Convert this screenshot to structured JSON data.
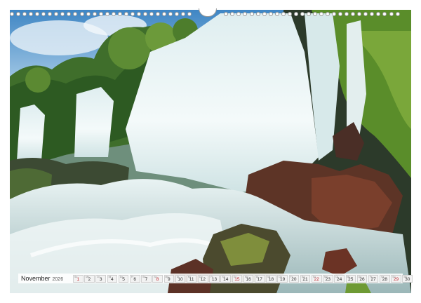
{
  "calendar": {
    "month": "November",
    "year": "2026",
    "days": [
      {
        "n": "1",
        "w": "So",
        "sun": true
      },
      {
        "n": "2",
        "w": "Mo"
      },
      {
        "n": "3",
        "w": "Di"
      },
      {
        "n": "4",
        "w": "Mi"
      },
      {
        "n": "5",
        "w": "Do"
      },
      {
        "n": "6",
        "w": "Fr"
      },
      {
        "n": "7",
        "w": "Sa"
      },
      {
        "n": "8",
        "w": "So",
        "sun": true
      },
      {
        "n": "9",
        "w": "Mo"
      },
      {
        "n": "10",
        "w": "Di"
      },
      {
        "n": "11",
        "w": "Mi"
      },
      {
        "n": "12",
        "w": "Do"
      },
      {
        "n": "13",
        "w": "Fr"
      },
      {
        "n": "14",
        "w": "Sa"
      },
      {
        "n": "15",
        "w": "So",
        "sun": true
      },
      {
        "n": "16",
        "w": "Mo"
      },
      {
        "n": "17",
        "w": "Di"
      },
      {
        "n": "18",
        "w": "Mi"
      },
      {
        "n": "19",
        "w": "Do"
      },
      {
        "n": "20",
        "w": "Fr"
      },
      {
        "n": "21",
        "w": "Sa"
      },
      {
        "n": "22",
        "w": "So",
        "sun": true
      },
      {
        "n": "23",
        "w": "Mo"
      },
      {
        "n": "24",
        "w": "Di"
      },
      {
        "n": "25",
        "w": "Mi"
      },
      {
        "n": "26",
        "w": "Do"
      },
      {
        "n": "27",
        "w": "Fr"
      },
      {
        "n": "28",
        "w": "Sa"
      },
      {
        "n": "29",
        "w": "So",
        "sun": true
      },
      {
        "n": "30",
        "w": "Mo"
      }
    ]
  },
  "colors": {
    "sunday": "#c0262d",
    "strip_bg": "#ffffff"
  },
  "photo": {
    "subject": "waterfall-photo"
  }
}
